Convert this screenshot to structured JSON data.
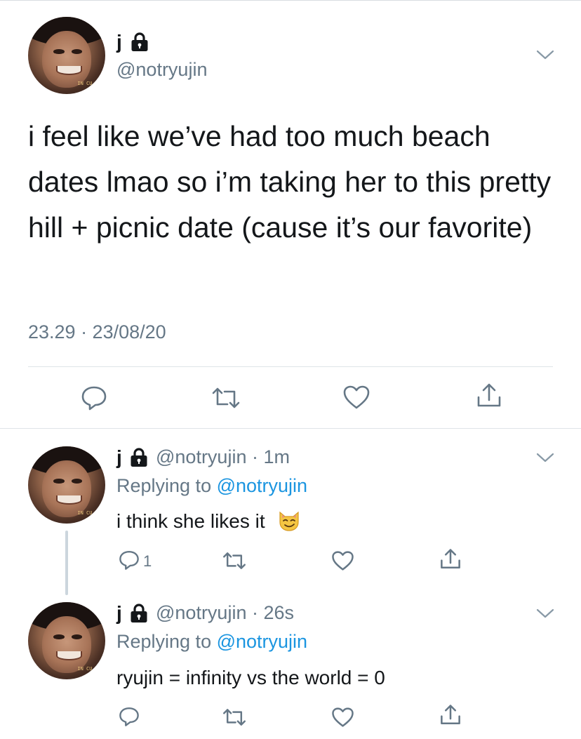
{
  "main_tweet": {
    "display_name": "j",
    "handle": "@notryujin",
    "text": "i feel like we’ve had too much beach dates lmao so i’m taking her to this pretty hill + picnic date (cause it’s our favorite)",
    "timestamp": "23.29 · 23/08/20",
    "avatar_tag": "IN CU"
  },
  "replies": [
    {
      "display_name": "j",
      "meta": "@notryujin · 1m",
      "replying_prefix": "Replying to ",
      "replying_handle": "@notryujin",
      "text": "i think she likes it",
      "reply_count": "1",
      "avatar_tag": "IN CU"
    },
    {
      "display_name": "j",
      "meta": "@notryujin · 26s",
      "replying_prefix": "Replying to ",
      "replying_handle": "@notryujin",
      "text": "ryujin = infinity vs the world = 0",
      "avatar_tag": "IN CU"
    }
  ],
  "icons": {
    "lock": "lock-icon",
    "chevron": "chevron-down-icon",
    "reply": "reply-icon",
    "retweet": "retweet-icon",
    "like": "heart-icon",
    "share": "share-icon",
    "emoji": "smirking-cat-emoji"
  },
  "colors": {
    "text": "#14171a",
    "secondary": "#657786",
    "link": "#1b95e0",
    "divider": "#dfe4e8",
    "thread_line": "#ccd6dd"
  }
}
